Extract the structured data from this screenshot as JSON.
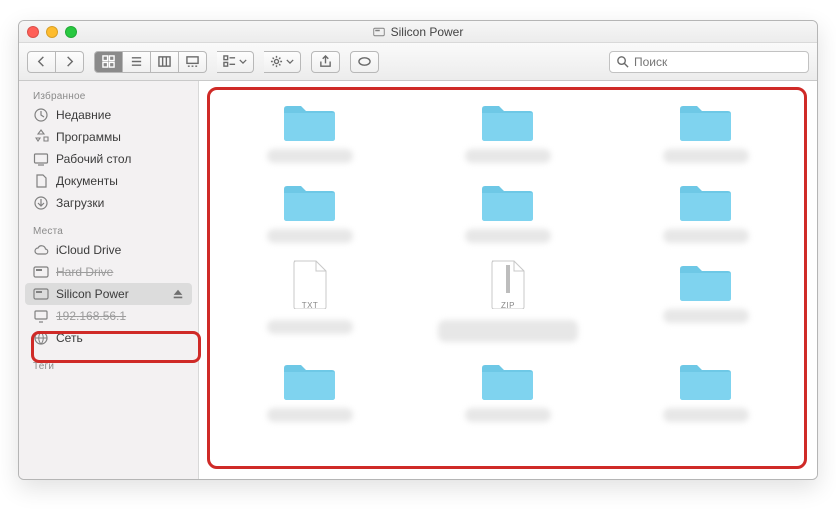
{
  "window": {
    "title": "Silicon Power"
  },
  "toolbar": {
    "group_dropdown": "≡",
    "action_dropdown": "⚙",
    "search_placeholder": "Поиск"
  },
  "sidebar": {
    "sections": {
      "favorites": "Избранное",
      "locations": "Места",
      "tags": "Теги"
    },
    "favorites": [
      {
        "label": "Недавние",
        "icon": "clock"
      },
      {
        "label": "Программы",
        "icon": "apps"
      },
      {
        "label": "Рабочий стол",
        "icon": "desktop"
      },
      {
        "label": "Документы",
        "icon": "documents"
      },
      {
        "label": "Загрузки",
        "icon": "downloads"
      }
    ],
    "locations": [
      {
        "label": "iCloud Drive",
        "icon": "cloud",
        "eject": false,
        "selected": false,
        "struck": false
      },
      {
        "label": "Hard Drive",
        "icon": "disk",
        "eject": false,
        "selected": false,
        "struck": true
      },
      {
        "label": "Silicon Power",
        "icon": "disk",
        "eject": true,
        "selected": true,
        "struck": false
      },
      {
        "label": "192.168.56.1",
        "icon": "display",
        "eject": false,
        "selected": false,
        "struck": true
      },
      {
        "label": "Сеть",
        "icon": "globe",
        "eject": false,
        "selected": false,
        "struck": false
      }
    ]
  },
  "content": {
    "items": [
      {
        "type": "folder"
      },
      {
        "type": "folder"
      },
      {
        "type": "folder"
      },
      {
        "type": "folder"
      },
      {
        "type": "folder"
      },
      {
        "type": "folder"
      },
      {
        "type": "file",
        "ext": "TXT"
      },
      {
        "type": "file",
        "ext": "ZIP",
        "wide_label": true
      },
      {
        "type": "folder"
      },
      {
        "type": "folder"
      },
      {
        "type": "folder"
      },
      {
        "type": "folder"
      }
    ]
  }
}
